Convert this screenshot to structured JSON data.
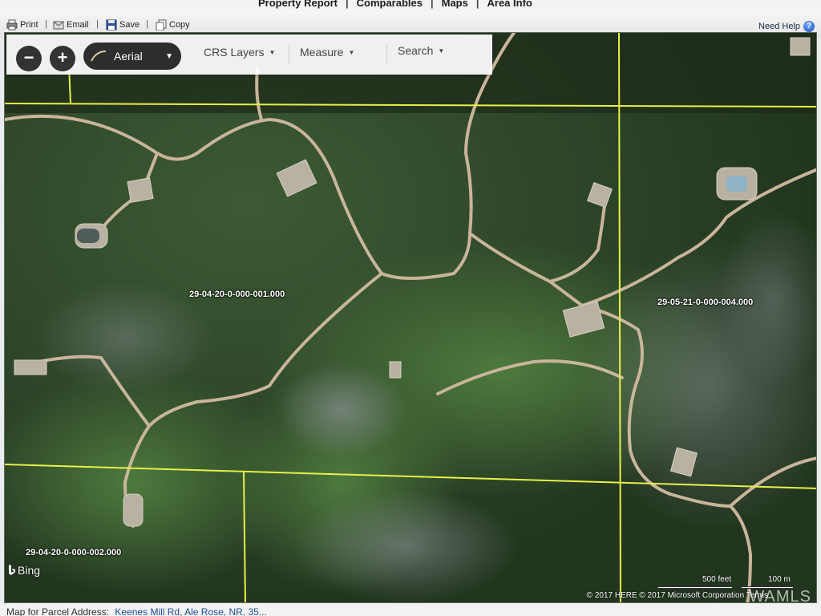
{
  "top_nav": {
    "items": [
      "Property Report",
      "Comparables",
      "Maps",
      "Area Info"
    ],
    "separator": "|"
  },
  "actions": {
    "print": "Print",
    "email": "Email",
    "save": "Save",
    "copy": "Copy",
    "separator": "|",
    "need_help": "Need Help",
    "help_glyph": "?"
  },
  "map_toolbar": {
    "zoom_out": "−",
    "zoom_in": "+",
    "basemap_selected": "Aerial",
    "crs_layers": "CRS Layers",
    "measure": "Measure",
    "search": "Search",
    "caret": "▼"
  },
  "parcels": [
    "29-04-20-0-000-001.000",
    "29-05-21-0-000-004.000",
    "29-04-20-0-000-002.000"
  ],
  "map_attribution": {
    "bing": "Bing",
    "scale_feet": "500 feet",
    "scale_meters": "100 m",
    "copyright": "© 2017 HERE © 2017 Microsoft Corporation Terms",
    "watermark": "WAMLS"
  },
  "footer": {
    "label": "Map for Parcel Address:",
    "address": "Keenes Mill Rd, Ale Rose, NR, 35..."
  },
  "colors": {
    "parcel_line": "#e6f04a",
    "road": "#c9b59a",
    "forest": "#2f4a2a"
  }
}
